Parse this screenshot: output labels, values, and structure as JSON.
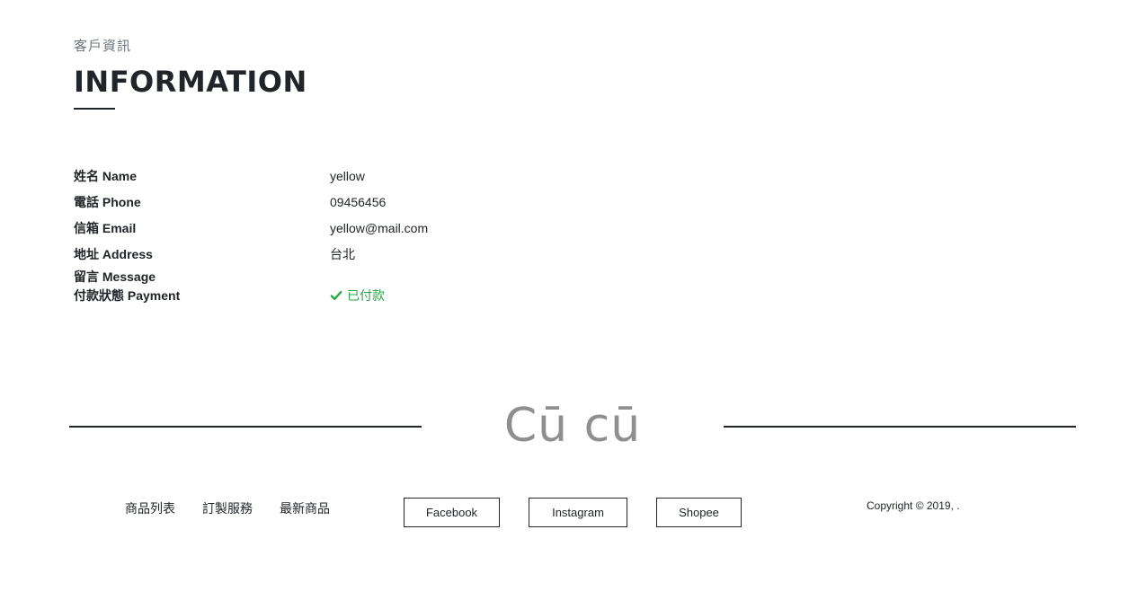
{
  "header": {
    "subtitle": "客戶資訊",
    "title": "INFORMATION"
  },
  "info": {
    "name": {
      "label": "姓名 Name",
      "value": "yellow"
    },
    "phone": {
      "label": "電話 Phone",
      "value": "09456456"
    },
    "email": {
      "label": "信箱 Email",
      "value": "yellow@mail.com"
    },
    "address": {
      "label": "地址 Address",
      "value": "台北"
    },
    "message": {
      "label": "留言 Message",
      "value": ""
    },
    "payment": {
      "label": "付款狀態 Payment",
      "value": "已付款",
      "icon": "check-icon",
      "color": "#28a745"
    }
  },
  "footer": {
    "logo": "Cū cū",
    "nav": [
      "商品列表",
      "訂製服務",
      "最新商品"
    ],
    "social": {
      "facebook": "Facebook",
      "instagram": "Instagram",
      "shopee": "Shopee"
    },
    "copyright": "Copyright © 2019, ."
  }
}
